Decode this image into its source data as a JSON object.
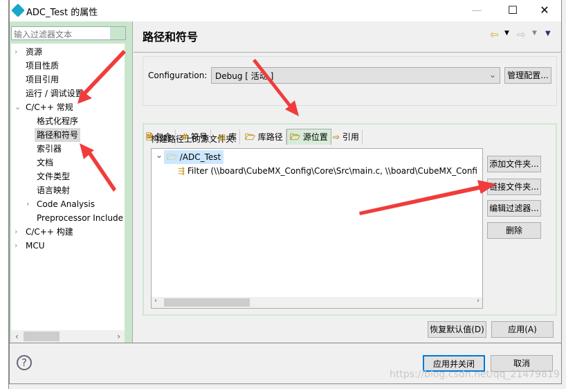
{
  "window": {
    "title": "ADC_Test 的属性",
    "minimize": "—",
    "maximize": "☐",
    "close": "✕"
  },
  "sidebar": {
    "filter_placeholder": "输入过滤器文本",
    "items": [
      {
        "label": "资源",
        "level": 0,
        "expander": "collapsed"
      },
      {
        "label": "项目性质",
        "level": 0
      },
      {
        "label": "项目引用",
        "level": 0
      },
      {
        "label": "运行 / 调试设置",
        "level": 0
      },
      {
        "label": "C/C++ 常规",
        "level": 0,
        "expander": "expanded"
      },
      {
        "label": "格式化程序",
        "level": 1
      },
      {
        "label": "路径和符号",
        "level": 1,
        "selected": true
      },
      {
        "label": "索引器",
        "level": 1
      },
      {
        "label": "文档",
        "level": 1
      },
      {
        "label": "文件类型",
        "level": 1
      },
      {
        "label": "语言映射",
        "level": 1
      },
      {
        "label": "Code Analysis",
        "level": 1,
        "expander": "collapsed"
      },
      {
        "label": "Preprocessor Include",
        "level": 1
      },
      {
        "label": "C/C++ 构建",
        "level": 0,
        "expander": "collapsed"
      },
      {
        "label": "MCU",
        "level": 0,
        "expander": "collapsed"
      }
    ]
  },
  "main": {
    "title": "路径和符号",
    "configuration_label": "Configuration:",
    "configuration_value": "Debug  [ 活动 ]",
    "manage_button": "管理配置...",
    "tabs": [
      {
        "label": "包含",
        "icon": "include-icon"
      },
      {
        "label": "符号",
        "icon": "hash-icon"
      },
      {
        "label": "库",
        "icon": "library-icon"
      },
      {
        "label": "库路径",
        "icon": "folder-icon"
      },
      {
        "label": "源位置",
        "icon": "source-folder-icon",
        "active": true
      },
      {
        "label": "引用",
        "icon": "reference-icon"
      }
    ],
    "source_label": "构建路径上的源文件夹:",
    "tree": {
      "root": "/ADC_Test",
      "child": "Filter (\\\\board\\CubeMX_Config\\Core\\Src\\main.c, \\\\board\\CubeMX_Confi"
    },
    "buttons": {
      "add": "添加文件夹...",
      "link": "链接文件夹...",
      "edit": "编辑过滤器...",
      "delete": "删除"
    },
    "restore": "恢复默认值(D)",
    "apply": "应用(A)"
  },
  "footer": {
    "apply_close": "应用并关闭",
    "cancel": "取消",
    "help": "?"
  },
  "watermark": "https://blog.csdn.net/qq_21479819",
  "colors": {
    "sidebar_bg": "#c9e6cc",
    "selection": "#cce8ff",
    "focus_border": "#0078d7",
    "arrow": "#f03c3c"
  }
}
